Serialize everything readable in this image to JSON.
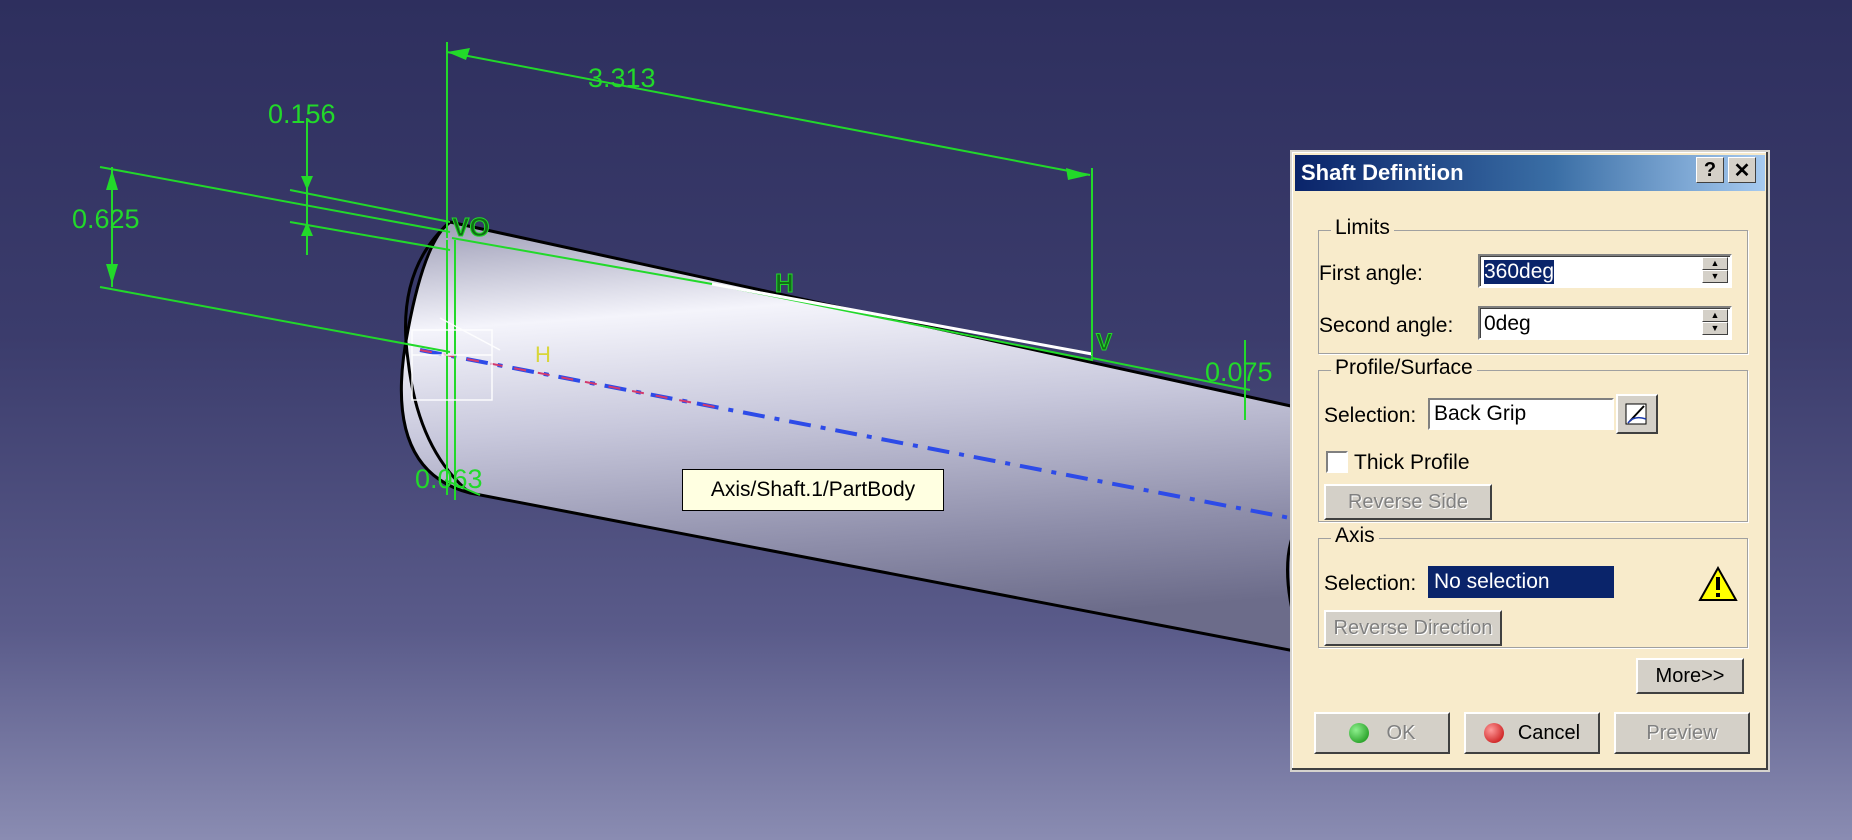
{
  "viewport": {
    "dimensions": {
      "d1": "3.313",
      "d2": "0.156",
      "d3": "0.625",
      "d4": "0.075",
      "d5": "0.063"
    },
    "constraints": {
      "c1": "VO",
      "c2": "H",
      "c3": "V",
      "c4": "H"
    },
    "tooltip": "Axis/Shaft.1/PartBody"
  },
  "dialog": {
    "title": "Shaft Definition",
    "help_label": "?",
    "close_label": "✕",
    "limits": {
      "label": "Limits",
      "first_angle_label": "First angle:",
      "first_angle_value": "360deg",
      "second_angle_label": "Second angle:",
      "second_angle_value": "0deg"
    },
    "profile": {
      "label": "Profile/Surface",
      "selection_label": "Selection:",
      "selection_value": "Back Grip",
      "thick_profile_label": "Thick Profile",
      "thick_profile_checked": false,
      "reverse_side_label": "Reverse Side"
    },
    "axis": {
      "label": "Axis",
      "selection_label": "Selection:",
      "selection_value": "No selection",
      "reverse_direction_label": "Reverse Direction"
    },
    "more_label": "More>>",
    "ok_label": "OK",
    "cancel_label": "Cancel",
    "preview_label": "Preview"
  }
}
